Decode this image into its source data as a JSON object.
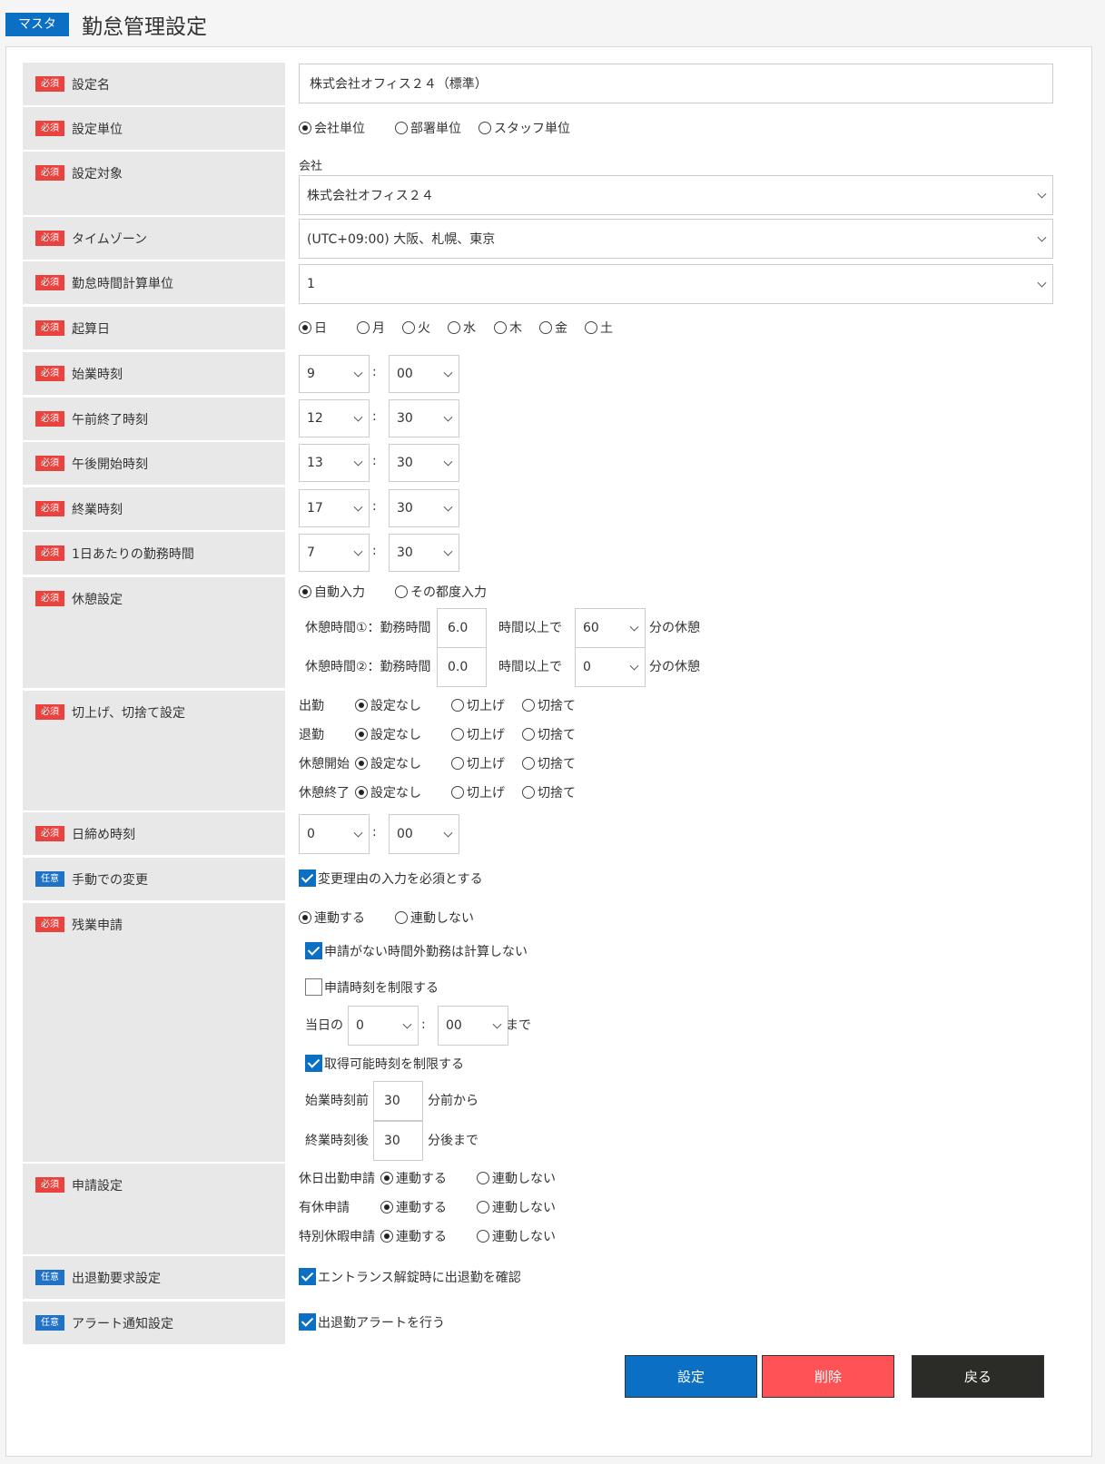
{
  "header": {
    "tag": "マスタ",
    "title": "勤怠管理設定"
  },
  "badges": {
    "req": "必須",
    "opt": "任意"
  },
  "labels": {
    "name": "設定名",
    "unit": "設定単位",
    "target": "設定対象",
    "tz": "タイムゾーン",
    "calc": "勤怠時間計算単位",
    "startday": "起算日",
    "start": "始業時刻",
    "amend": "午前終了時刻",
    "pmstart": "午後開始時刻",
    "end": "終業時刻",
    "daily": "1日あたりの勤務時間",
    "break": "休憩設定",
    "round": "切上げ、切捨て設定",
    "close": "日締め時刻",
    "manual": "手動での変更",
    "overtime": "残業申請",
    "apply": "申請設定",
    "entry": "出退勤要求設定",
    "alert": "アラート通知設定"
  },
  "fields": {
    "name": "株式会社オフィス２４（標準）",
    "unit_opts": [
      "会社単位",
      "部署単位",
      "スタッフ単位"
    ],
    "target_label": "会社",
    "target": "株式会社オフィス２４",
    "tz": "(UTC+09:00) 大阪、札幌、東京",
    "calc": "1",
    "days": [
      "日",
      "月",
      "火",
      "水",
      "木",
      "金",
      "土"
    ],
    "colon": ":",
    "start_h": "9",
    "start_m": "00",
    "amend_h": "12",
    "amend_m": "30",
    "pmstart_h": "13",
    "pmstart_m": "30",
    "end_h": "17",
    "end_m": "30",
    "daily_h": "7",
    "daily_m": "30",
    "break_opts": [
      "自動入力",
      "その都度入力"
    ],
    "break1_label": "休憩時間①：勤務時間",
    "break1_val": "6.0",
    "break2_label": "休憩時間②：勤務時間",
    "break2_val": "0.0",
    "break_mid": "時間以上で",
    "break1_min": "60",
    "break2_min": "0",
    "break_tail": "分の休憩",
    "round_rows": [
      "出勤",
      "退勤",
      "休憩開始",
      "休憩終了"
    ],
    "round_opts": [
      "設定なし",
      "切上げ",
      "切捨て"
    ],
    "close_h": "0",
    "close_m": "00",
    "manual_chk": "変更理由の入力を必須とする",
    "ot_opts": [
      "連動する",
      "連動しない"
    ],
    "ot_chk1": "申請がない時間外勤務は計算しない",
    "ot_chk2": "申請時刻を制限する",
    "ot_day": "当日の",
    "ot_h": "0",
    "ot_m": "00",
    "ot_until": "まで",
    "ot_chk3": "取得可能時刻を制限する",
    "ot_before": "始業時刻前",
    "ot_before_val": "30",
    "ot_before_tail": "分前から",
    "ot_after": "終業時刻後",
    "ot_after_val": "30",
    "ot_after_tail": "分後まで",
    "apply_rows": [
      "休日出勤申請",
      "有休申請",
      "特別休暇申請"
    ],
    "apply_opts": [
      "連動する",
      "連動しない"
    ],
    "entry_chk": "エントランス解錠時に出退勤を確認",
    "alert_chk": "出退勤アラートを行う"
  },
  "buttons": {
    "save": "設定",
    "delete": "削除",
    "back": "戻る"
  },
  "colors": {
    "accent": "#0b6fc4",
    "danger": "#fd5356",
    "dark": "#2b2b27",
    "required": "#e8433f"
  }
}
